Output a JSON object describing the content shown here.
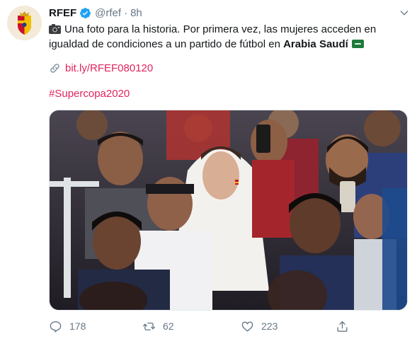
{
  "tweet": {
    "display_name": "RFEF",
    "handle": "@rfef",
    "separator": "·",
    "time": "8h",
    "text_line1": "Una foto para la historia. Por primera vez, las mujeres acceden en",
    "text_line2_start": "igualdad de condiciones a un partido de fútbol en ",
    "text_line2_bold": "Arabia Saudí",
    "link": "bit.ly/RFEF080120",
    "hashtag": "#Supercopa2020"
  },
  "actions": {
    "replies": "178",
    "retweets": "62",
    "likes": "223"
  },
  "icons": {
    "avatar": "rfef-crest-icon",
    "verified": "verified-badge-icon",
    "menu": "chevron-down-icon",
    "camera": "camera-emoji-icon",
    "flag": "saudi-flag-emoji-icon",
    "link": "link-icon",
    "reply": "reply-icon",
    "retweet": "retweet-icon",
    "like": "heart-icon",
    "share": "share-icon"
  },
  "colors": {
    "link": "#e0245e",
    "verified": "#1da1f2",
    "muted": "#657786",
    "text": "#14171a"
  }
}
